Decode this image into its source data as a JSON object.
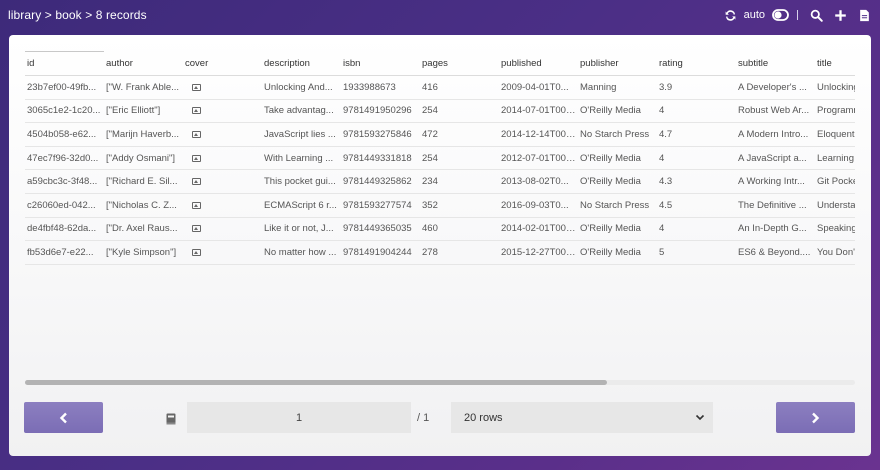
{
  "breadcrumb": "library > book > 8 records",
  "toolbar": {
    "auto_label": "auto",
    "icons": [
      "refresh-icon",
      "toggle-icon",
      "search-icon",
      "plus-icon",
      "document-icon"
    ]
  },
  "table": {
    "columns": [
      "id",
      "author",
      "cover",
      "description",
      "isbn",
      "pages",
      "published",
      "publisher",
      "rating",
      "subtitle",
      "title"
    ],
    "rows": [
      [
        "23b7ef00-49fb...",
        "[\"W. Frank Able...",
        "",
        "Unlocking And...",
        "1933988673",
        "416",
        "2009-04-01T0...",
        "Manning",
        "3.9",
        "A Developer's ...",
        "Unlocking"
      ],
      [
        "3065c1e2-1c20...",
        "[\"Eric Elliott\"]",
        "",
        "Take advantag...",
        "9781491950296",
        "254",
        "2014-07-01T00:...",
        "O'Reilly Media",
        "4",
        "Robust Web Ar...",
        "Programm"
      ],
      [
        "4504b058-e62...",
        "[\"Marijn Haverb...",
        "",
        "JavaScript lies ...",
        "9781593275846",
        "472",
        "2014-12-14T00:...",
        "No Starch Press",
        "4.7",
        "A Modern Intro...",
        "Eloquent"
      ],
      [
        "47ec7f96-32d0...",
        "[\"Addy Osmani\"]",
        "",
        "With Learning ...",
        "9781449331818",
        "254",
        "2012-07-01T00:...",
        "O'Reilly Media",
        "4",
        "A JavaScript a...",
        "Learning"
      ],
      [
        "a59cbc3c-3f48...",
        "[\"Richard E. Sil...",
        "",
        "This pocket gui...",
        "9781449325862",
        "234",
        "2013-08-02T0...",
        "O'Reilly Media",
        "4.3",
        "A Working Intr...",
        "Git Pocke"
      ],
      [
        "c26060ed-042...",
        "[\"Nicholas C. Z...",
        "",
        "ECMAScript 6 r...",
        "9781593277574",
        "352",
        "2016-09-03T0...",
        "No Starch Press",
        "4.5",
        "The Definitive ...",
        "Understa"
      ],
      [
        "de4fbf48-62da...",
        "[\"Dr. Axel Raus...",
        "",
        "Like it or not, J...",
        "9781449365035",
        "460",
        "2014-02-01T00:...",
        "O'Reilly Media",
        "4",
        "An In-Depth G...",
        "Speaking"
      ],
      [
        "fb53d6e7-e22...",
        "[\"Kyle Simpson\"]",
        "",
        "No matter how ...",
        "9781491904244",
        "278",
        "2015-12-27T00:...",
        "O'Reilly Media",
        "5",
        "ES6 & Beyond....",
        "You Don't"
      ]
    ]
  },
  "pagination": {
    "page": "1",
    "total": "/ 1",
    "rows_option": "20 rows"
  },
  "colors": {
    "accent": "#7b6db5",
    "background": "#4b2f86"
  }
}
